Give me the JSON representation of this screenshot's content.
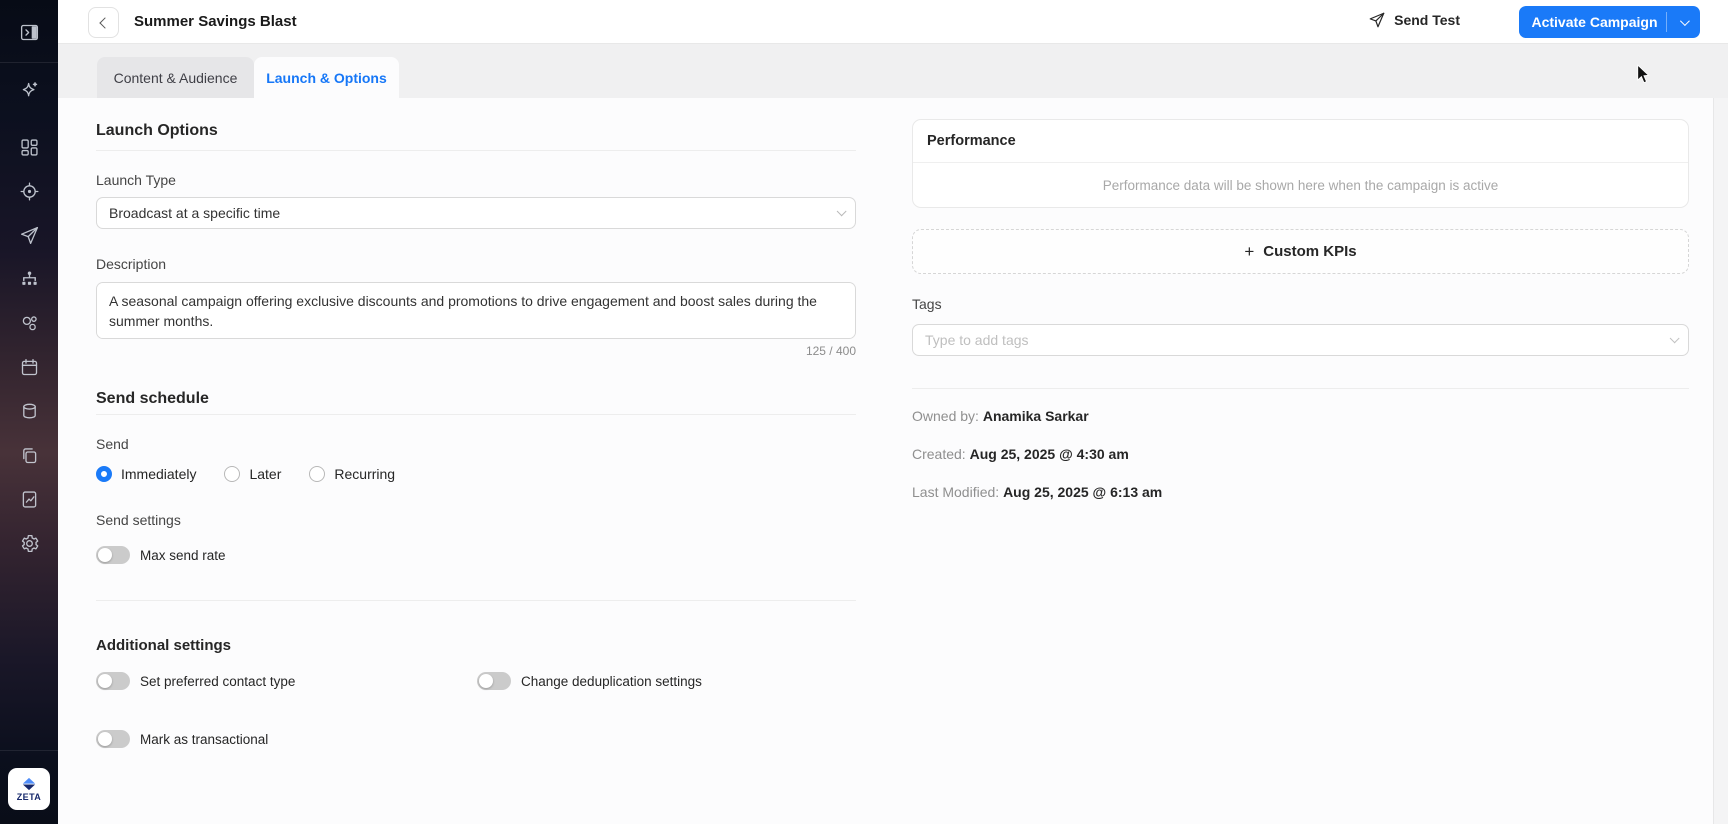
{
  "colors": {
    "accent": "#1a7af8",
    "sidebar_top": "#070b16",
    "sidebar_mid": "#483239"
  },
  "header": {
    "title": "Summer Savings Blast",
    "send_test_label": "Send Test",
    "activate_label": "Activate Campaign"
  },
  "tabs": [
    {
      "label": "Content & Audience",
      "active": false
    },
    {
      "label": "Launch & Options",
      "active": true
    }
  ],
  "launch_options": {
    "heading": "Launch Options",
    "launch_type_label": "Launch Type",
    "launch_type_value": "Broadcast at a specific time",
    "description_label": "Description",
    "description_value": "A seasonal campaign offering exclusive discounts and promotions to drive engagement and boost sales during the summer months.",
    "char_counter": "125 / 400"
  },
  "send_schedule": {
    "heading": "Send schedule",
    "send_label": "Send",
    "options": [
      {
        "label": "Immediately",
        "selected": true
      },
      {
        "label": "Later",
        "selected": false
      },
      {
        "label": "Recurring",
        "selected": false
      }
    ],
    "send_settings_label": "Send settings",
    "max_send_rate_label": "Max send rate"
  },
  "additional_settings": {
    "heading": "Additional settings",
    "toggles": [
      {
        "label": "Set preferred contact type",
        "on": false
      },
      {
        "label": "Change deduplication settings",
        "on": false
      },
      {
        "label": "Mark as transactional",
        "on": false
      }
    ]
  },
  "performance": {
    "heading": "Performance",
    "empty_text": "Performance data will be shown here when the campaign is active"
  },
  "custom_kpis": {
    "plus": "+",
    "label": "Custom KPIs"
  },
  "tags": {
    "label": "Tags",
    "placeholder": "Type to add tags"
  },
  "meta": {
    "owned_by_label": "Owned by:",
    "owned_by_value": "Anamika Sarkar",
    "created_label": "Created:",
    "created_value": "Aug 25, 2025 @ 4:30 am",
    "modified_label": "Last Modified:",
    "modified_value": "Aug 25, 2025 @ 6:13 am"
  },
  "sidebar": {
    "logo_text": "ZETA",
    "icons": [
      "panel-toggle",
      "ai-sparkle",
      "dashboard",
      "target",
      "send-plane",
      "org-chart",
      "segments",
      "calendar",
      "database",
      "copy-pages",
      "report-doc",
      "settings-gear"
    ]
  }
}
